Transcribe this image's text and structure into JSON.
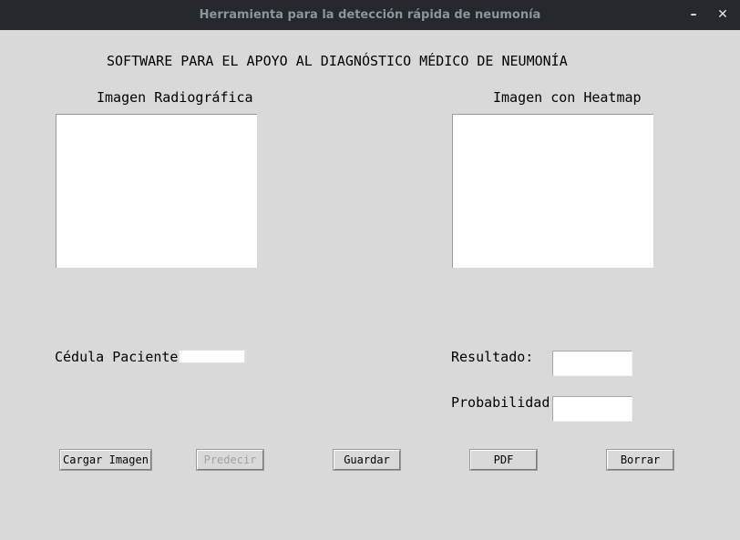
{
  "window": {
    "title": "Herramienta para la detección rápida de neumonía",
    "minimize_glyph": "–",
    "close_glyph": "✕"
  },
  "main": {
    "heading": "SOFTWARE PARA EL APOYO AL DIAGNÓSTICO MÉDICO DE NEUMONÍA",
    "xray_label": "Imagen Radiográfica",
    "heatmap_label": "Imagen con Heatmap",
    "patient_id_label": "Cédula Paciente",
    "patient_id_value": "",
    "result_label": "Resultado:",
    "result_value": "",
    "probability_label": "Probabilidad:",
    "probability_value": ""
  },
  "buttons": {
    "load": "Cargar Imagen",
    "predict": "Predecir",
    "save": "Guardar",
    "pdf": "PDF",
    "clear": "Borrar"
  }
}
